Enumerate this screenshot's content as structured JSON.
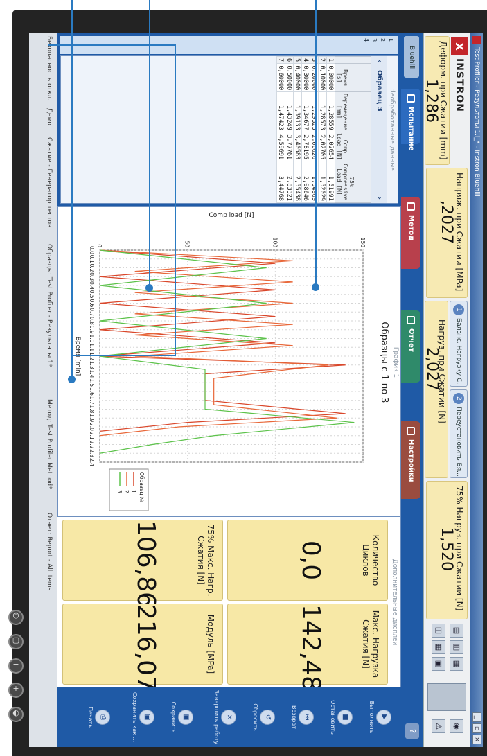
{
  "window": {
    "title": "Test Profiler - Результаты 1.i_* - Instron Bluehill"
  },
  "brand": {
    "mark": "X",
    "name": "INSTRON"
  },
  "readouts": [
    {
      "label": "Деформ. при Сжатии [mm]",
      "value": "1,286"
    },
    {
      "label": "Напряж. при Сжатии [MPa]",
      "value": ",2027"
    },
    {
      "label": "Нагруз. при Сжатии [N]",
      "value": "2,027"
    },
    {
      "label": "75% Нагруз. при Сжатии [N]",
      "value": "1,520"
    }
  ],
  "quick_buttons": [
    {
      "num": "1",
      "label": "Баланс. Нагрузку С..."
    },
    {
      "num": "2",
      "label": "Переустановить Бя..."
    }
  ],
  "tabs": [
    {
      "label": "Испытание",
      "color": "#1f5aa6"
    },
    {
      "label": "Метод",
      "color": "#b8404c"
    },
    {
      "label": "Отчет",
      "color": "#2f8a6a"
    },
    {
      "label": "Настройки",
      "color": "#9a4c3f"
    }
  ],
  "sidebar": {
    "bluehill": "Bluehill",
    "items": [
      "1",
      "2",
      "3",
      "4"
    ]
  },
  "raw_data": {
    "header": "Необработанные данные",
    "specimen": "Образец 3",
    "columns": [
      "",
      "Время [s]",
      "Перемещение [mm]",
      "Comp load [N]",
      "75% Compressive Load [N]"
    ],
    "rows": [
      [
        "1",
        "0,00000",
        "1,28559",
        "2,02654",
        "1,51991"
      ],
      [
        "2",
        "0,10000",
        "1,28573",
        "2,02705",
        "1,52029"
      ],
      [
        "3",
        "0,20000",
        "1,29323",
        "2,06626",
        "1,54969"
      ],
      [
        "4",
        "0,30000",
        "1,34677",
        "2,78195",
        "2,08646"
      ],
      [
        "5",
        "0,40000",
        "1,39133",
        "3,40583",
        "2,55438"
      ],
      [
        "6",
        "0,50000",
        "1,43249",
        "3,77761",
        "2,83321"
      ],
      [
        "7",
        "0,60000",
        "1,47423",
        "4,59691",
        "3,44768"
      ]
    ]
  },
  "graph": {
    "panel_title": "График 1",
    "subtitle": "Образцы с 1 по 3",
    "legend_title": "Образец №",
    "legend": [
      "1",
      "2",
      "3"
    ]
  },
  "chart_data": {
    "type": "line",
    "xlabel": "Время [min]",
    "ylabel": "Comp load [N]",
    "xlim": [
      0,
      2.4
    ],
    "ylim": [
      0,
      150
    ],
    "xticks": [
      "0.0",
      "0.1",
      "0.2",
      "0.3",
      "0.4",
      "0.5",
      "0.6",
      "0.7",
      "0.8",
      "0.9",
      "1.0",
      "1.1",
      "1.2",
      "1.3",
      "1.4",
      "1.5",
      "1.6",
      "1.7",
      "1.8",
      "1.9",
      "2.0",
      "2.1",
      "2.2",
      "2.3",
      "2.4"
    ],
    "yticks": [
      "0",
      "50",
      "100",
      "150"
    ],
    "grid": true,
    "legend_position": "right",
    "series": [
      {
        "name": "1",
        "color": "#d9472b",
        "x": [
          0,
          0.15,
          0.3,
          0.45,
          0.6,
          0.75,
          0.9,
          1.05,
          1.2,
          1.3,
          1.4,
          1.55,
          1.7,
          1.85,
          1.95,
          2.05
        ],
        "y": [
          0,
          100,
          0,
          100,
          0,
          100,
          0,
          100,
          0,
          140,
          60,
          60,
          60,
          140,
          50,
          0
        ]
      },
      {
        "name": "2",
        "color": "#e8683a",
        "x": [
          0,
          0.12,
          0.24,
          0.36,
          0.48,
          0.6,
          0.72,
          0.84,
          0.96,
          1.08,
          1.2,
          1.3,
          1.45,
          1.6,
          1.75,
          1.9,
          2.0,
          2.1
        ],
        "y": [
          0,
          110,
          20,
          110,
          20,
          110,
          20,
          110,
          20,
          110,
          20,
          130,
          65,
          65,
          65,
          135,
          45,
          0
        ]
      },
      {
        "name": "3",
        "color": "#5cc24a",
        "x": [
          0,
          0.2,
          0.4,
          0.6,
          0.8,
          1.0,
          1.2,
          1.35,
          1.5,
          1.65,
          1.8,
          1.95,
          2.1,
          2.2,
          2.3
        ],
        "y": [
          0,
          95,
          0,
          95,
          0,
          95,
          0,
          60,
          60,
          60,
          60,
          145,
          65,
          30,
          0
        ]
      }
    ]
  },
  "displays": {
    "header": "Дополнительные дисплеи",
    "cards": [
      {
        "label": "Количество Циклов",
        "value": "0,0"
      },
      {
        "label": "Макс. Нагрузка Сжатия [N]",
        "value": "142,48"
      },
      {
        "label": "75% Макс. Нагр. Сжатия [N]",
        "value": "106,86"
      },
      {
        "label": "Модуль [MPa]",
        "value": "216,07"
      }
    ]
  },
  "actions": [
    {
      "label": "Выполнить",
      "icon": "play-icon",
      "glyph": "▶"
    },
    {
      "label": "Остановить",
      "icon": "stop-icon",
      "glyph": "■"
    },
    {
      "label": "Возврат",
      "icon": "return-icon",
      "glyph": "⏮"
    },
    {
      "label": "Сбросить",
      "icon": "reset-icon",
      "glyph": "↺"
    },
    {
      "label": "Завершить работу",
      "icon": "finish-icon",
      "glyph": "✕"
    },
    {
      "label": "Сохранить",
      "icon": "save-icon",
      "glyph": "▣"
    },
    {
      "label": "Сохранить как ...",
      "icon": "save-as-icon",
      "glyph": "▣"
    },
    {
      "label": "Печать",
      "icon": "print-icon",
      "glyph": "⎙"
    }
  ],
  "statusbar": {
    "items": [
      "Безопасность откл.",
      "Демо",
      "Сжатие - Генератор тестов",
      "Образцы: Test Profiler - Результаты 1*",
      "Метод: Test Profiler Method*",
      "Отчет: Report - All Items"
    ]
  },
  "colors": {
    "accent": "#1f5aa6",
    "callout": "#2a7ac1",
    "readout_bg": "#f7eab3"
  }
}
